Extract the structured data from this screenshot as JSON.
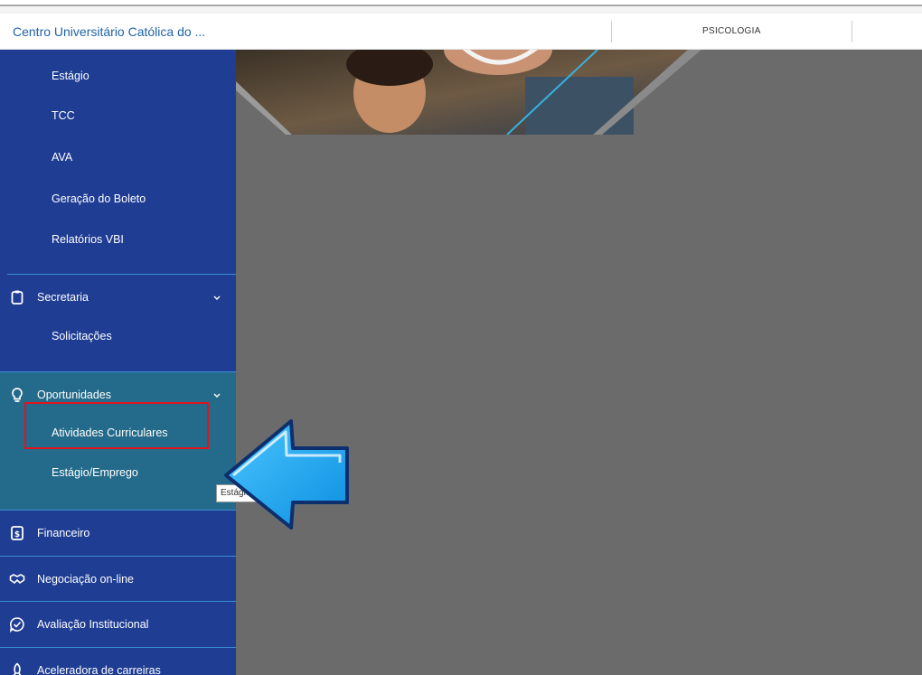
{
  "header": {
    "institution": "Centro Universitário Católica do ...",
    "course": "PSICOLOGIA"
  },
  "sidebar": {
    "top_subitems": [
      "Estágio",
      "TCC",
      "AVA",
      "Geração do Boleto",
      "Relatórios VBI"
    ],
    "secretaria": {
      "label": "Secretaria",
      "icon": "clipboard-icon",
      "subitems": [
        "Solicitações"
      ]
    },
    "oportunidades": {
      "label": "Oportunidades",
      "icon": "lightbulb-icon",
      "subitems": [
        "Atividades Curriculares",
        "Estágio/Emprego"
      ]
    },
    "financeiro": {
      "label": "Financeiro",
      "icon": "dollar-document-icon"
    },
    "negociacao": {
      "label": "Negociação on-line",
      "icon": "handshake-icon"
    },
    "avaliacao": {
      "label": "Avaliação Institucional",
      "icon": "chat-check-icon"
    },
    "aceleradora": {
      "label": "Aceleradora de carreiras",
      "icon": "rocket-icon"
    }
  },
  "tooltip": {
    "text": "Estágio/Emprego"
  },
  "colors": {
    "sidebar": "#1e3d93",
    "active_section": "#246a8a",
    "divider": "#3a8fd4",
    "main_overlay": "#6b6b6b",
    "highlight_box": "#e0141c",
    "annotation_arrow": "#1aa9f0",
    "institution_text": "#1f63a8"
  }
}
